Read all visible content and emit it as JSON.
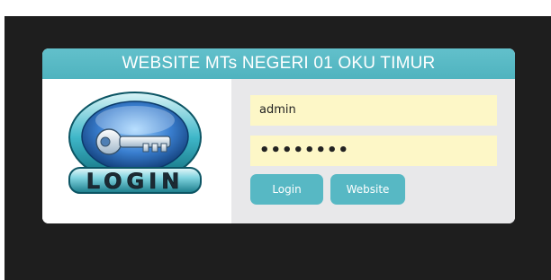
{
  "header": {
    "title": "WEBSITE MTs NEGERI 01 OKU TIMUR"
  },
  "logo": {
    "text": "LOGIN",
    "icon": "key-icon"
  },
  "form": {
    "username_value": "admin",
    "password_value": "••••••••",
    "login_label": "Login",
    "website_label": "Website"
  },
  "colors": {
    "page_background": "#1e1e1e",
    "header": "#57b8c4",
    "button": "#57b8c4",
    "input_background": "#fdf7c7",
    "form_background": "#e8e8ea"
  }
}
